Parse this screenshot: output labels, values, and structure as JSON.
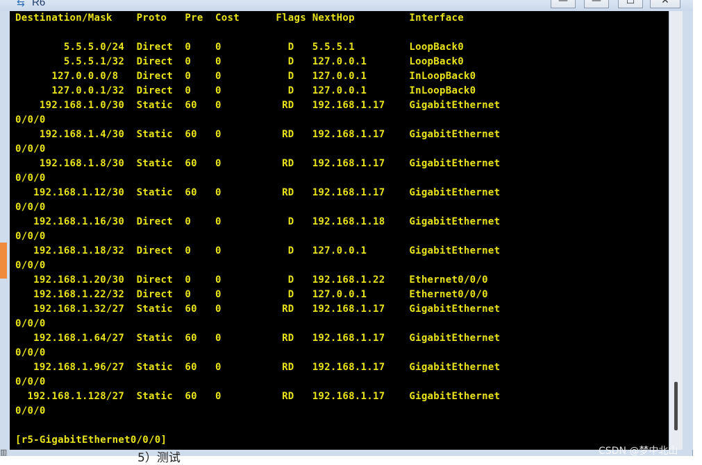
{
  "window": {
    "title": "R6",
    "buttons": [
      "—",
      "—",
      "☐",
      "✕"
    ]
  },
  "terminal": {
    "lines": [
      "Destination/Mask    Proto   Pre  Cost      Flags NextHop         Interface",
      "",
      "        5.5.5.0/24  Direct  0    0           D   5.5.5.1         LoopBack0",
      "        5.5.5.1/32  Direct  0    0           D   127.0.0.1       LoopBack0",
      "      127.0.0.0/8   Direct  0    0           D   127.0.0.1       InLoopBack0",
      "      127.0.0.1/32  Direct  0    0           D   127.0.0.1       InLoopBack0",
      "    192.168.1.0/30  Static  60   0          RD   192.168.1.17    GigabitEthernet",
      "0/0/0",
      "    192.168.1.4/30  Static  60   0          RD   192.168.1.17    GigabitEthernet",
      "0/0/0",
      "    192.168.1.8/30  Static  60   0          RD   192.168.1.17    GigabitEthernet",
      "0/0/0",
      "   192.168.1.12/30  Static  60   0          RD   192.168.1.17    GigabitEthernet",
      "0/0/0",
      "   192.168.1.16/30  Direct  0    0           D   192.168.1.18    GigabitEthernet",
      "0/0/0",
      "   192.168.1.18/32  Direct  0    0           D   127.0.0.1       GigabitEthernet",
      "0/0/0",
      "   192.168.1.20/30  Direct  0    0           D   192.168.1.22    Ethernet0/0/0",
      "   192.168.1.22/32  Direct  0    0           D   127.0.0.1       Ethernet0/0/0",
      "   192.168.1.32/27  Static  60   0          RD   192.168.1.17    GigabitEthernet",
      "0/0/0",
      "   192.168.1.64/27  Static  60   0          RD   192.168.1.17    GigabitEthernet",
      "0/0/0",
      "   192.168.1.96/27  Static  60   0          RD   192.168.1.17    GigabitEthernet",
      "0/0/0",
      "  192.168.1.128/27  Static  60   0          RD   192.168.1.17    GigabitEthernet",
      "0/0/0",
      "",
      "[r5-GigabitEthernet0/0/0]"
    ]
  },
  "document": {
    "caption": "5）测试",
    "watermark": "CSDN @梦中北山"
  },
  "colors": {
    "terminal_bg": "#000000",
    "terminal_fg": "#e9e31b",
    "chrome": "#cfdcec"
  }
}
